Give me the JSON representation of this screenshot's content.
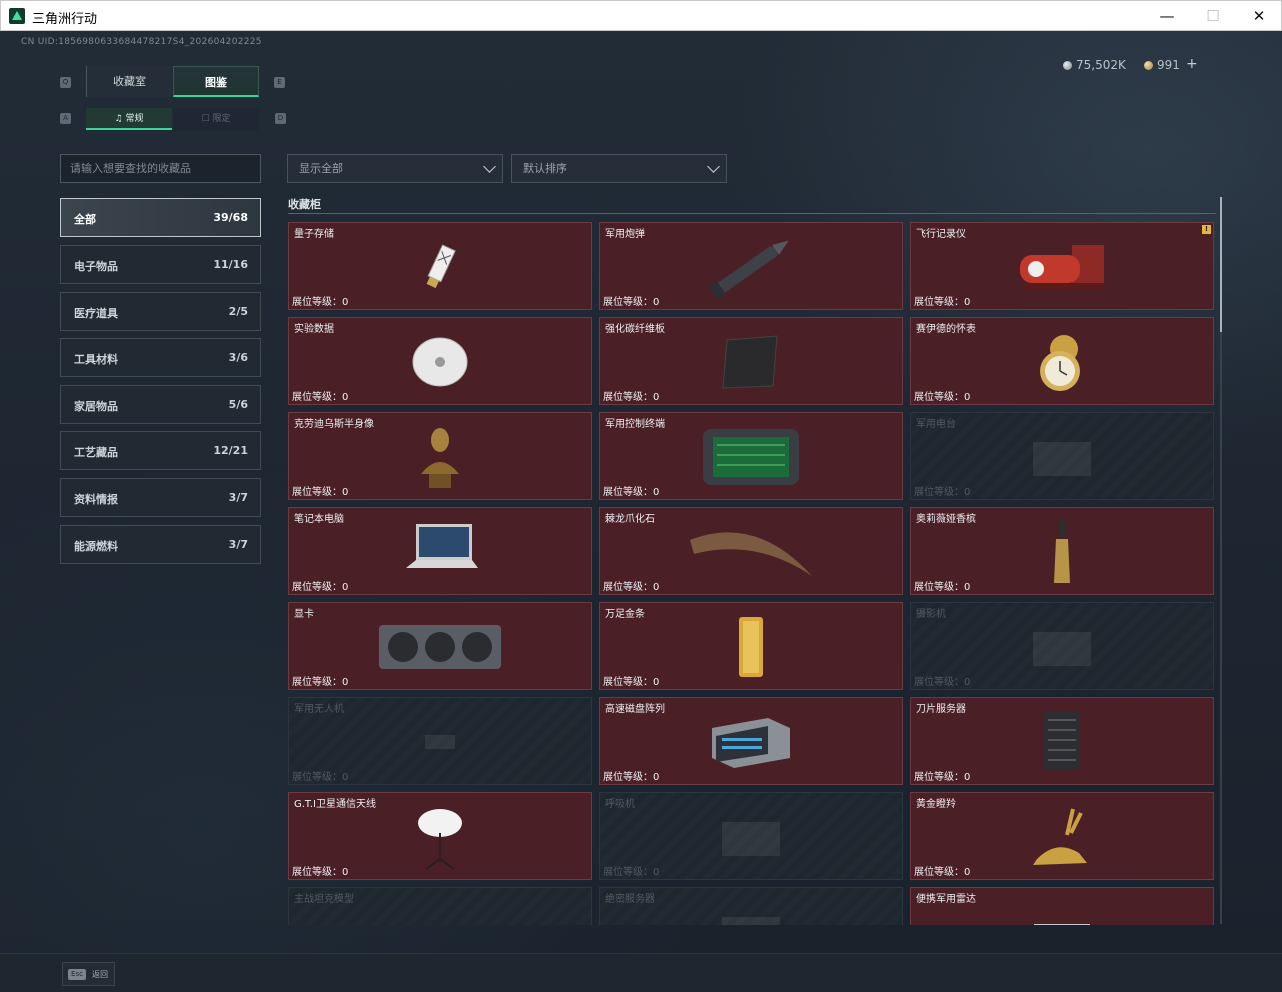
{
  "window": {
    "title": "三角洲行动"
  },
  "header": {
    "uid": "CN UID:1856980633684478217S4_202604202225",
    "currency_silver": "75,502K",
    "currency_gold": "991",
    "currency_plus": "+"
  },
  "tabs": {
    "main": [
      "收藏室",
      "图鉴"
    ],
    "sub": [
      "常规",
      "限定"
    ],
    "key_left": "Q",
    "key_right": "E",
    "subkey_left": "A",
    "subkey_right": "D"
  },
  "search": {
    "placeholder": "请输入想要查找的收藏品"
  },
  "categories": [
    {
      "label": "全部",
      "count": "39/68"
    },
    {
      "label": "电子物品",
      "count": "11/16"
    },
    {
      "label": "医疗道具",
      "count": "2/5"
    },
    {
      "label": "工具材料",
      "count": "3/6"
    },
    {
      "label": "家居物品",
      "count": "5/6"
    },
    {
      "label": "工艺藏品",
      "count": "12/21"
    },
    {
      "label": "资料情报",
      "count": "3/7"
    },
    {
      "label": "能源燃料",
      "count": "3/7"
    }
  ],
  "filters": {
    "show": "显示全部",
    "sort": "默认排序"
  },
  "section": {
    "title": "收藏柜"
  },
  "level_label": "展位等级：0",
  "items": [
    {
      "name": "量子存储",
      "unlocked": true,
      "icon": "usb-drive-icon"
    },
    {
      "name": "军用炮弹",
      "unlocked": true,
      "icon": "artillery-shell-icon"
    },
    {
      "name": "飞行记录仪",
      "unlocked": true,
      "icon": "flight-recorder-icon",
      "warn": "!"
    },
    {
      "name": "实验数据",
      "unlocked": true,
      "icon": "disc-icon"
    },
    {
      "name": "强化碳纤维板",
      "unlocked": true,
      "icon": "carbon-plate-icon"
    },
    {
      "name": "赛伊德的怀表",
      "unlocked": true,
      "icon": "pocket-watch-icon"
    },
    {
      "name": "克劳迪乌斯半身像",
      "unlocked": true,
      "icon": "bust-icon"
    },
    {
      "name": "军用控制终端",
      "unlocked": true,
      "icon": "control-terminal-icon"
    },
    {
      "name": "军用电台",
      "unlocked": false,
      "icon": "radio-icon"
    },
    {
      "name": "笔记本电脑",
      "unlocked": true,
      "icon": "laptop-icon"
    },
    {
      "name": "棘龙爪化石",
      "unlocked": true,
      "icon": "claw-fossil-icon"
    },
    {
      "name": "奥莉薇娅香槟",
      "unlocked": true,
      "icon": "champagne-icon"
    },
    {
      "name": "显卡",
      "unlocked": true,
      "icon": "graphics-card-icon"
    },
    {
      "name": "万足金条",
      "unlocked": true,
      "icon": "gold-bar-icon"
    },
    {
      "name": "摄影机",
      "unlocked": false,
      "icon": "camera-icon"
    },
    {
      "name": "军用无人机",
      "unlocked": false,
      "icon": "drone-icon"
    },
    {
      "name": "高速磁盘阵列",
      "unlocked": true,
      "icon": "disk-array-icon"
    },
    {
      "name": "刀片服务器",
      "unlocked": true,
      "icon": "blade-server-icon"
    },
    {
      "name": "G.T.I卫星通信天线",
      "unlocked": true,
      "icon": "satellite-dish-icon"
    },
    {
      "name": "呼吸机",
      "unlocked": false,
      "icon": "ventilator-icon"
    },
    {
      "name": "黄金瞪羚",
      "unlocked": true,
      "icon": "golden-gazelle-icon"
    },
    {
      "name": "主战坦克模型",
      "unlocked": false,
      "icon": "tank-model-icon"
    },
    {
      "name": "绝密服务器",
      "unlocked": false,
      "icon": "server-icon"
    },
    {
      "name": "便携军用雷达",
      "unlocked": true,
      "icon": "radar-icon"
    }
  ],
  "footer": {
    "esc_key": "Esc",
    "back_label": "返回"
  }
}
